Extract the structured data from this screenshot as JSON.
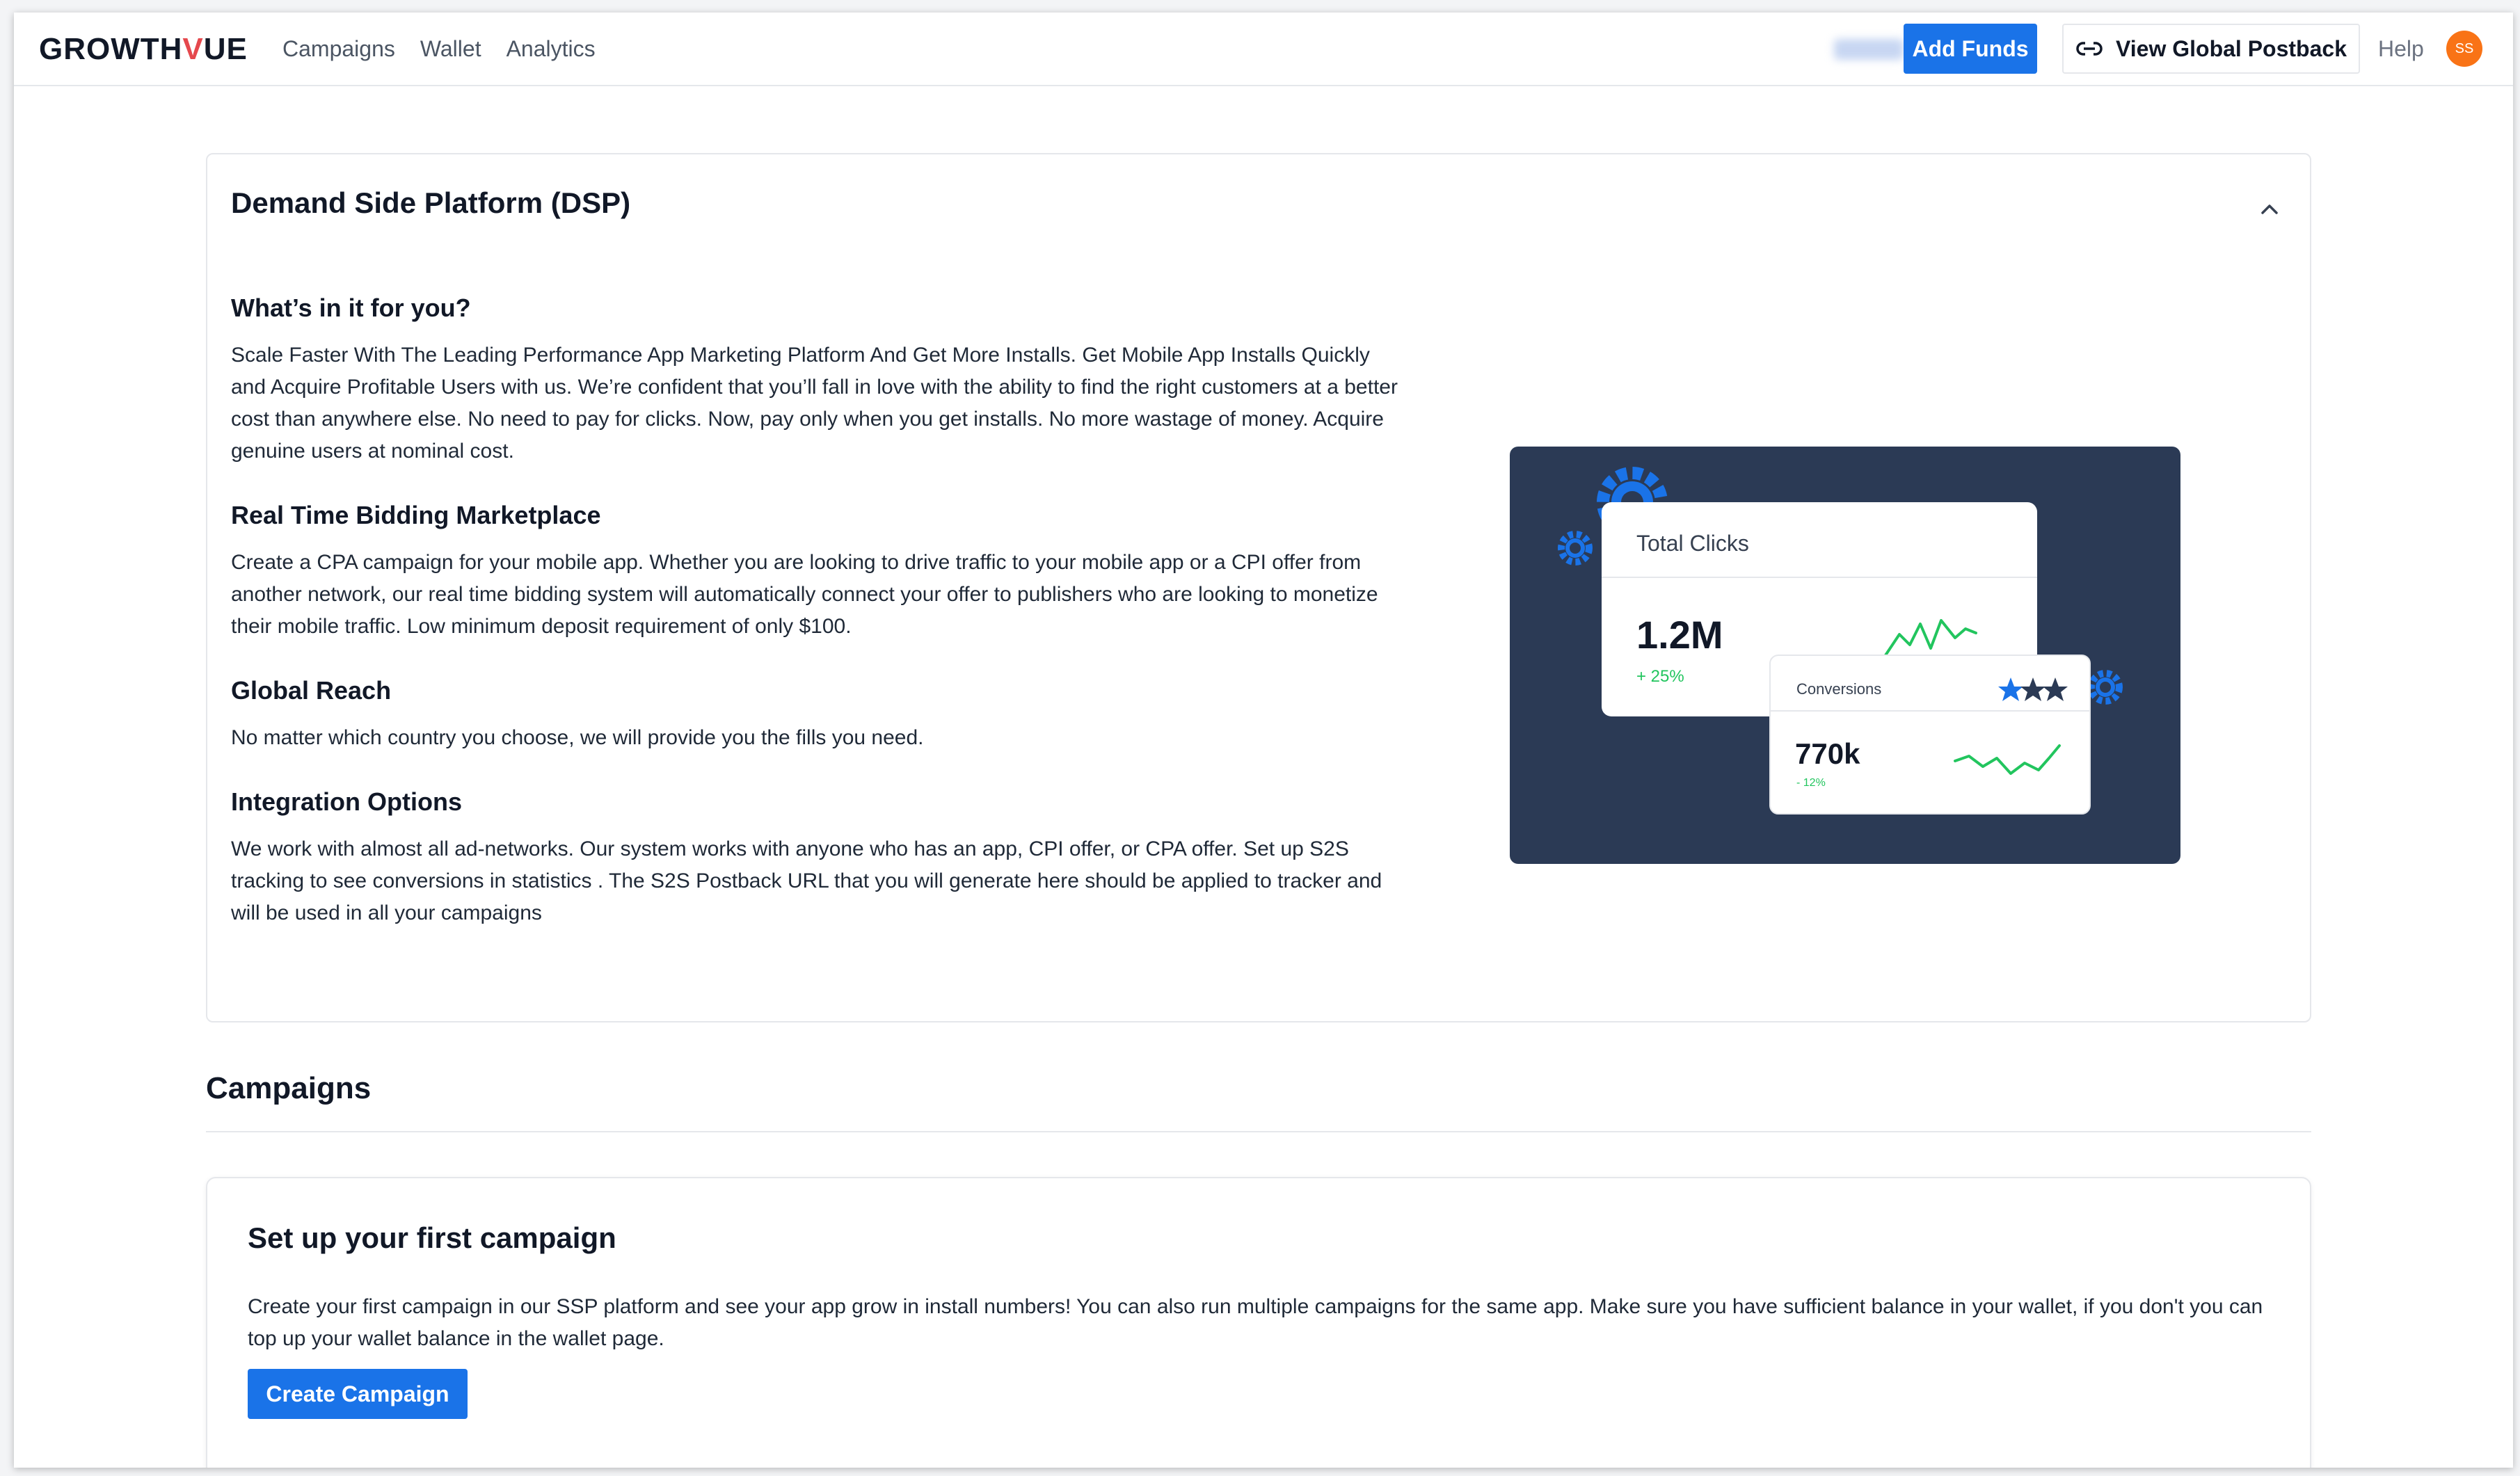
{
  "header": {
    "logo_pre": "GROWTH",
    "logo_v": "V",
    "logo_post": "UE",
    "nav": [
      {
        "label": "Campaigns"
      },
      {
        "label": "Wallet"
      },
      {
        "label": "Analytics"
      }
    ],
    "add_funds_label": "Add Funds",
    "view_postback_label": "View Global Postback",
    "help_label": "Help",
    "avatar_initials": "SS"
  },
  "dsp": {
    "title": "Demand Side Platform (DSP)",
    "sections": [
      {
        "heading": "What’s in it for you?",
        "text": "Scale Faster With The Leading Performance App Marketing Platform And Get More Installs. Get Mobile App Installs Quickly and Acquire Profitable Users with us. We’re confident that you’ll fall in love with the ability to find the right customers at a better cost than anywhere else. No need to pay for clicks. Now, pay only when you get installs. No more wastage of money. Acquire genuine users at nominal cost."
      },
      {
        "heading": "Real Time Bidding Marketplace",
        "text": "Create a CPA campaign for your mobile app. Whether you are looking to drive traffic to your mobile app or a CPI offer from another network, our real time bidding system will automatically connect your offer to publishers who are looking to monetize their mobile traffic. Low minimum deposit requirement of only $100."
      },
      {
        "heading": "Global Reach",
        "text": "No matter which country you choose, we will provide you the fills you need."
      },
      {
        "heading": "Integration Options",
        "text": "We work with almost all ad-networks. Our system works with anyone who has an app, CPI offer, or CPA offer. Set up S2S tracking to see conversions in statistics . The S2S Postback URL that you will generate here should be applied to tracker and will be used in all your campaigns"
      }
    ],
    "illustration": {
      "clicks_label": "Total Clicks",
      "clicks_value": "1.2M",
      "clicks_change": "+ 25%",
      "conversions_label": "Conversions",
      "conversions_value": "770k",
      "conversions_change": "- 12%",
      "accent": "#1a73e8",
      "card_bg": "#2b3a55",
      "spark_color": "#22c55e"
    }
  },
  "campaigns": {
    "title": "Campaigns",
    "setup_title": "Set up your first campaign",
    "setup_text": "Create your first campaign in our SSP platform and see your app grow in install numbers! You can also run multiple campaigns for the same app. Make sure you have sufficient balance in your wallet, if you don't you can top up your wallet balance in the wallet page.",
    "create_label": "Create Campaign"
  }
}
